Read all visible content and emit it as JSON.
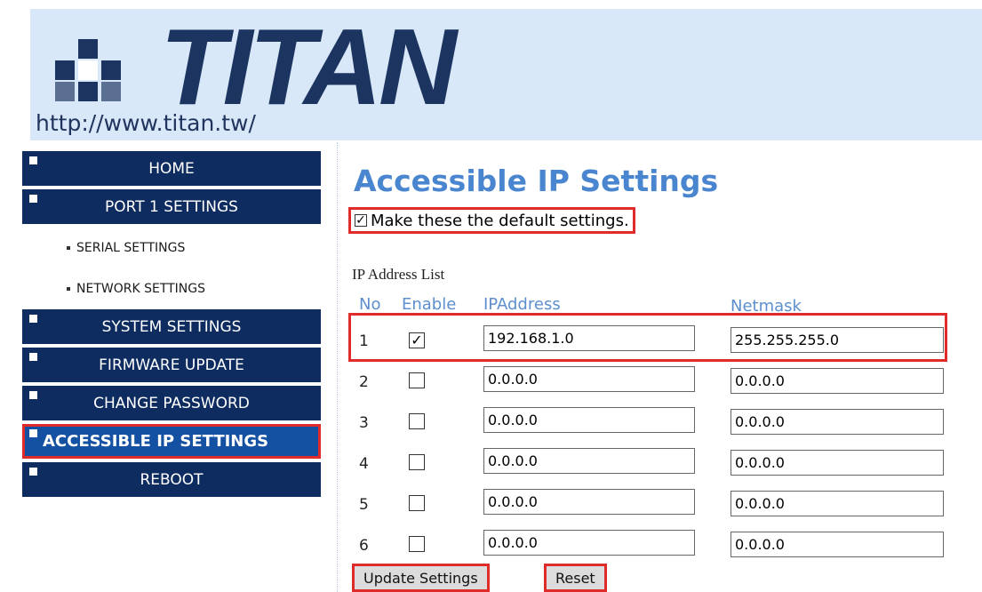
{
  "brand": {
    "logo_text": "TITAN",
    "url_text": "http://www.titan.tw/"
  },
  "sidebar": {
    "items": [
      {
        "label": "HOME"
      },
      {
        "label": "PORT 1 SETTINGS"
      },
      {
        "label": "SYSTEM SETTINGS"
      },
      {
        "label": "FIRMWARE UPDATE"
      },
      {
        "label": "CHANGE PASSWORD"
      },
      {
        "label": "ACCESSIBLE IP SETTINGS",
        "active": true
      },
      {
        "label": "REBOOT"
      }
    ],
    "subitems": [
      {
        "label": "SERIAL SETTINGS"
      },
      {
        "label": "NETWORK SETTINGS"
      }
    ]
  },
  "main": {
    "title": "Accessible IP Settings",
    "default_checkbox": {
      "label": "Make these the default settings.",
      "checked": true
    },
    "list_title": "IP Address List",
    "columns": {
      "no": "No",
      "enable": "Enable",
      "ip": "IPAddress",
      "netmask": "Netmask"
    },
    "rows": [
      {
        "no": "1",
        "enabled": true,
        "ip": "192.168.1.0",
        "netmask": "255.255.255.0"
      },
      {
        "no": "2",
        "enabled": false,
        "ip": "0.0.0.0",
        "netmask": "0.0.0.0"
      },
      {
        "no": "3",
        "enabled": false,
        "ip": "0.0.0.0",
        "netmask": "0.0.0.0"
      },
      {
        "no": "4",
        "enabled": false,
        "ip": "0.0.0.0",
        "netmask": "0.0.0.0"
      },
      {
        "no": "5",
        "enabled": false,
        "ip": "0.0.0.0",
        "netmask": "0.0.0.0"
      },
      {
        "no": "6",
        "enabled": false,
        "ip": "0.0.0.0",
        "netmask": "0.0.0.0"
      }
    ],
    "buttons": {
      "update": "Update Settings",
      "reset": "Reset"
    }
  },
  "colors": {
    "nav_bg": "#0e2c60",
    "nav_active_bg": "#1451a3",
    "highlight": "#e02b2b",
    "title": "#4a86cf",
    "header_bg": "#d8e8f8"
  }
}
